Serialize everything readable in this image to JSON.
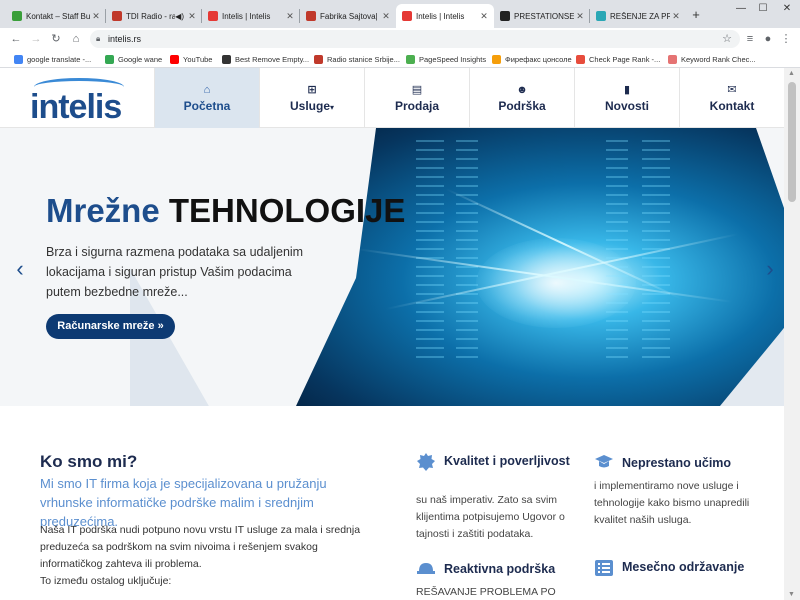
{
  "browser": {
    "tabs": [
      {
        "title": "Kontakt – Staff Bu",
        "color": "#3a9f3a",
        "active": false
      },
      {
        "title": "TDI Radio - ra",
        "color": "#c0392b",
        "active": false
      },
      {
        "title": "Intelis | Intelis",
        "color": "#e53935",
        "active": false
      },
      {
        "title": "Fabrika Sajtova| Ra",
        "color": "#c0392b",
        "active": false
      },
      {
        "title": "Intelis | Intelis",
        "color": "#e53935",
        "active": true
      },
      {
        "title": "PRESTATIONSET |",
        "color": "#222222",
        "active": false
      },
      {
        "title": "REŠENJE ZA PRO",
        "color": "#2aa7b5",
        "active": false
      }
    ],
    "window": {
      "minimize": "—",
      "maximize": "☐",
      "close": "✕"
    },
    "url": "intelis.rs",
    "bookmarks": [
      {
        "label": "google translate -...",
        "color": "#4285f4"
      },
      {
        "label": "Google wane",
        "color": "#34a853"
      },
      {
        "label": "YouTube",
        "color": "#ff0000"
      },
      {
        "label": "Best Remove Empty...",
        "color": "#333333"
      },
      {
        "label": "Radio stanice Srbije...",
        "color": "#c0392b"
      },
      {
        "label": "PageSpeed Insights",
        "color": "#4caf50"
      },
      {
        "label": "Фирефакс цонсоле",
        "color": "#f59e0b"
      },
      {
        "label": "Check Page Rank -...",
        "color": "#e74c3c"
      },
      {
        "label": "Keyword Rank Chec...",
        "color": "#e57373"
      }
    ]
  },
  "site": {
    "logo": "intelis",
    "nav": [
      {
        "label": "Početna",
        "icon": "home-icon",
        "glyph": "⌂",
        "active": true
      },
      {
        "label": "Usluge",
        "icon": "sitemap-icon",
        "glyph": "⊞",
        "active": false,
        "caret": "▾"
      },
      {
        "label": "Prodaja",
        "icon": "shop-icon",
        "glyph": "▤",
        "active": false
      },
      {
        "label": "Podrška",
        "icon": "user-support-icon",
        "glyph": "☻",
        "active": false
      },
      {
        "label": "Novosti",
        "icon": "bookmark-icon",
        "glyph": "▮",
        "active": false
      },
      {
        "label": "Kontakt",
        "icon": "envelope-icon",
        "glyph": "✉",
        "active": false
      }
    ],
    "hero": {
      "title_a": "Mrežne",
      "title_b": "TEHNOLOGIJE",
      "text": "Brza i sigurna razmena podataka sa udaljenim lokacijama i siguran pristup Vašim podacima putem bezbedne mreže...",
      "button": "Računarske mreže »",
      "prev": "‹",
      "next": "›"
    },
    "about": {
      "title": "Ko smo mi?",
      "lead": "Mi smo IT firma koja je specijalizovana u pružanju vrhunske informatičke podrške malim i srednjim preduzećima.",
      "body": "Naša IT podrška nudi potpuno novu vrstu IT usluge za mala i srednja preduzeća sa podrškom na svim nivoima i rešenjem svakog informatičkog zahteva ili problema.",
      "body2": "To između ostalog uključuje:"
    },
    "features": [
      {
        "title": "Kvalitet i poverljivost",
        "text": "su naš imperativ. Zato sa svim klijentima potpisujemo Ugovor o tajnosti i zaštiti podataka.",
        "icon": "badge-icon"
      },
      {
        "title": "Neprestano učimo",
        "text": "i implementiramo nove usluge i tehnologije kako bismo unapredili kvalitet naših usluga.",
        "icon": "graduation-cap-icon"
      },
      {
        "title": "Reaktivna podrška",
        "text": "REŠAVANJE PROBLEMA PO",
        "icon": "helmet-icon"
      },
      {
        "title": "Mesečno održavanje",
        "text": "",
        "icon": "list-icon"
      }
    ]
  }
}
